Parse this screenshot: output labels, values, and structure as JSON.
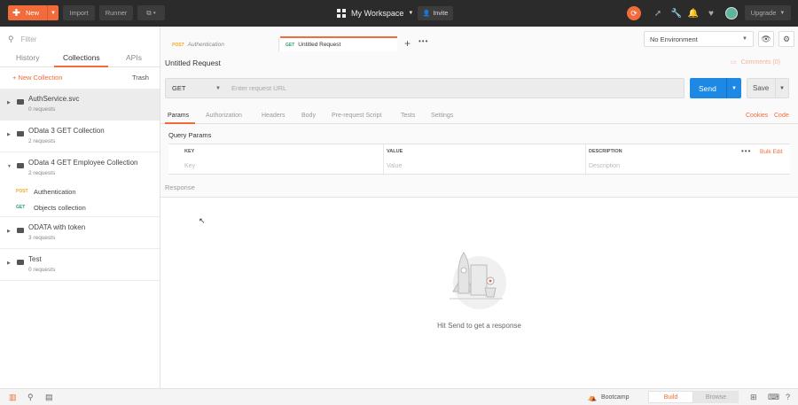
{
  "topbar": {
    "new_label": "New",
    "import_label": "Import",
    "runner_label": "Runner",
    "workspace_label": "My Workspace",
    "invite_label": "Invite",
    "upgrade_label": "Upgrade"
  },
  "sidebar": {
    "filter_placeholder": "Filter",
    "tabs": [
      {
        "label": "History"
      },
      {
        "label": "Collections"
      },
      {
        "label": "APIs"
      }
    ],
    "new_collection_label": "+ New Collection",
    "trash_label": "Trash",
    "collections": [
      {
        "name": "AuthService.svc",
        "count": "0 requests"
      },
      {
        "name": "OData 3 GET Collection",
        "count": "2 requests"
      },
      {
        "name": "OData 4 GET Employee Collection",
        "count": "2 requests"
      },
      {
        "name": "ODATA with token",
        "count": "3 requests"
      },
      {
        "name": "Test",
        "count": "0 requests"
      }
    ],
    "requests": [
      {
        "method": "POST",
        "name": "Authentication"
      },
      {
        "method": "GET",
        "name": "Objects collection"
      }
    ]
  },
  "tabs": [
    {
      "method": "POST",
      "name": "Authentication"
    },
    {
      "method": "GET",
      "name": "Untitled Request"
    }
  ],
  "environment": {
    "selected": "No Environment"
  },
  "request": {
    "title": "Untitled Request",
    "comments_label": "Comments (0)",
    "method": "GET",
    "url_placeholder": "Enter request URL",
    "send_label": "Send",
    "save_label": "Save"
  },
  "subtabs": [
    {
      "label": "Params"
    },
    {
      "label": "Authorization"
    },
    {
      "label": "Headers"
    },
    {
      "label": "Body"
    },
    {
      "label": "Pre-request Script"
    },
    {
      "label": "Tests"
    },
    {
      "label": "Settings"
    }
  ],
  "cookies_label": "Cookies",
  "code_label": "Code",
  "query_params": {
    "title": "Query Params",
    "headers": {
      "key": "KEY",
      "value": "VALUE",
      "description": "DESCRIPTION"
    },
    "placeholders": {
      "key": "Key",
      "value": "Value",
      "description": "Description"
    },
    "bulk_edit_label": "Bulk Edit"
  },
  "response": {
    "title": "Response",
    "hint": "Hit Send to get a response"
  },
  "bottombar": {
    "bootcamp_label": "Bootcamp",
    "build_label": "Build",
    "browse_label": "Browse"
  },
  "colors": {
    "accent": "#f26b3a",
    "send_blue": "#1e88e5",
    "get_green": "#2c9d68",
    "post_orange": "#f5a623"
  }
}
